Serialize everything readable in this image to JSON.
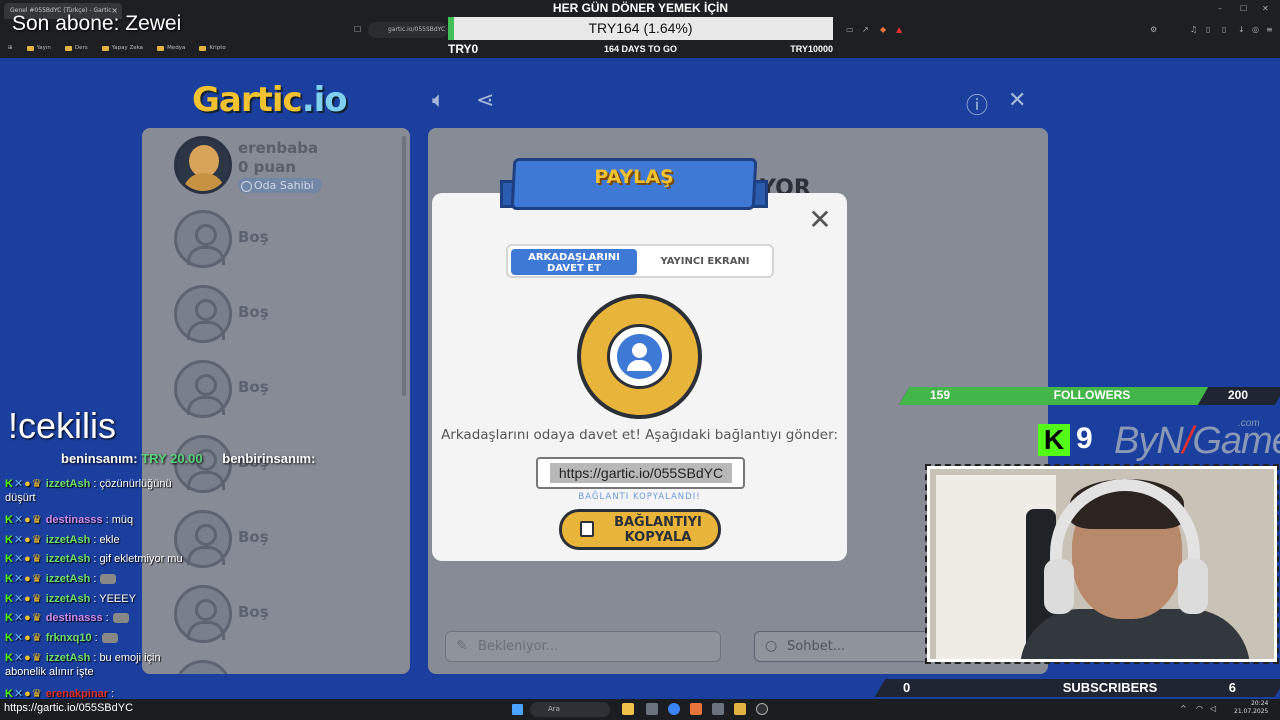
{
  "browser": {
    "tab_title": "Genel #055BdYC (Türkçe) - Gartic",
    "address": "gartic.io/055SBdYC",
    "bookmarks": [
      "Yayın",
      "Ders",
      "Yapay Zeka",
      "Medya",
      "Kripto"
    ]
  },
  "overlay": {
    "son_abone": "Son abone: Zewei",
    "goal": {
      "title": "HER GÜN DÖNER YEMEK İÇİN",
      "value_text": "TRY164 (1.64%)",
      "progress_percent": 1.64,
      "start": "TRY0",
      "days": "164 DAYS TO GO",
      "end": "TRY10000",
      "fill_color": "#40c057"
    },
    "followers": {
      "current": "159",
      "label": "FOLLOWERS",
      "goal": "200",
      "progress_fraction": 0.795
    },
    "kick_count": "9",
    "brand": {
      "pre": "ByN",
      "slash": "/",
      "post": "Game",
      "suffix": ".com"
    },
    "subscribers": {
      "current": "0",
      "label": "SUBSCRIBERS",
      "goal": "6"
    },
    "cekilis": "!cekilis",
    "donation": {
      "user": "beninsanım:",
      "amount": "TRY 20.00",
      "user2": "benbirinsanım:"
    }
  },
  "chat": [
    {
      "user": "izzetAsh",
      "color": "#6fe06f",
      "text": ": çözünürlüğünü",
      "cont": "düşürt",
      "emote": false
    },
    {
      "user": "destinasss",
      "color": "#d08cf0",
      "text": ": müq",
      "emote": false
    },
    {
      "user": "izzetAsh",
      "color": "#6fe06f",
      "text": ": ekle",
      "emote": false
    },
    {
      "user": "izzetAsh",
      "color": "#6fe06f",
      "text": ": gif ekletmiyor mu",
      "emote": false
    },
    {
      "user": "izzetAsh",
      "color": "#6fe06f",
      "text": ":",
      "emote": true
    },
    {
      "user": "izzetAsh",
      "color": "#6fe06f",
      "text": ": YEEEY",
      "emote": false
    },
    {
      "user": "destinasss",
      "color": "#d08cf0",
      "text": ":",
      "emote": true
    },
    {
      "user": "frknxq10",
      "color": "#6fe06f",
      "text": ":",
      "emote": true
    },
    {
      "user": "izzetAsh",
      "color": "#6fe06f",
      "text": ": bu emoji için",
      "cont": "abonelik alınır işte",
      "emote": false
    },
    {
      "user": "erenakpinar",
      "color": "#e03131",
      "text": ":",
      "emote": false
    }
  ],
  "gartic": {
    "logo_main": "Gartic",
    "logo_suffix": ".io",
    "owner": {
      "name": "erenbaba",
      "points": "0 puan",
      "badge": "Oda Sahibi"
    },
    "empty_slot_label": "Boş",
    "partial_word": "YOR",
    "guess_placeholder": "Bekleniyor...",
    "chat_placeholder": "Sohbet..."
  },
  "modal": {
    "title": "PAYLAŞ",
    "tab_invite": "ARKADAŞLARINI DAVET ET",
    "tab_streamer": "YAYINCI EKRANI",
    "invite_text": "Arkadaşlarını odaya davet et! Aşağıdaki bağlantıyı gönder:",
    "link": "https://gartic.io/055SBdYC",
    "copied": "BAĞLANTI KOPYALANDI!",
    "copy_button": "BAĞLANTIYI KOPYALA"
  },
  "taskbar": {
    "status_url": "https://gartic.io/055SBdYC",
    "search": "Ara",
    "time": "20:24",
    "date": "21.07.2025"
  }
}
